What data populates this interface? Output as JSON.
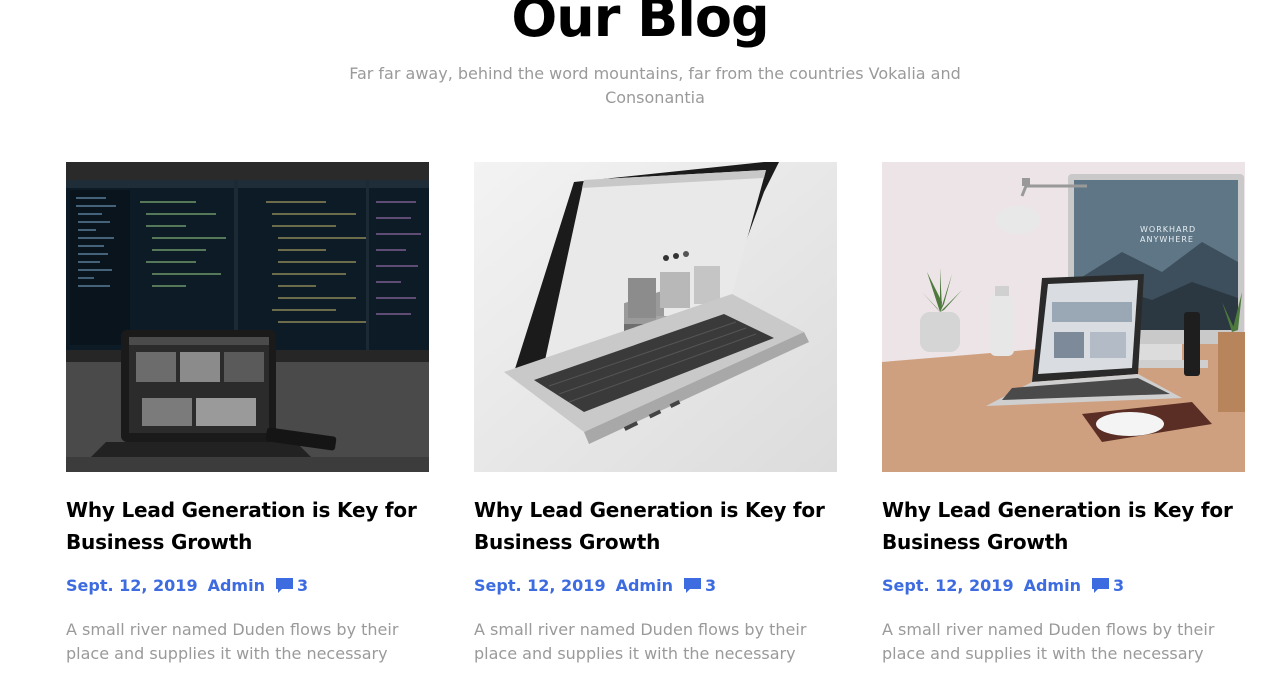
{
  "section": {
    "title": "Our Blog",
    "subtitle": "Far far away, behind the word mountains, far from the countries Vokalia and Consonantia"
  },
  "posts": [
    {
      "title": "Why Lead Generation is Key for Business Growth",
      "date": "Sept. 12, 2019",
      "author": "Admin",
      "comments": "3",
      "excerpt": "A small river named Duden flows by their place and supplies it with the necessary"
    },
    {
      "title": "Why Lead Generation is Key for Business Growth",
      "date": "Sept. 12, 2019",
      "author": "Admin",
      "comments": "3",
      "excerpt": "A small river named Duden flows by their place and supplies it with the necessary"
    },
    {
      "title": "Why Lead Generation is Key for Business Growth",
      "date": "Sept. 12, 2019",
      "author": "Admin",
      "comments": "3",
      "excerpt": "A small river named Duden flows by their place and supplies it with the necessary"
    }
  ],
  "photo_screen_text": {
    "workhard": "WORKHARD",
    "anywhere": "ANYWHERE"
  },
  "colors": {
    "accent": "#3d6be0",
    "muted": "#9a9a9a"
  }
}
